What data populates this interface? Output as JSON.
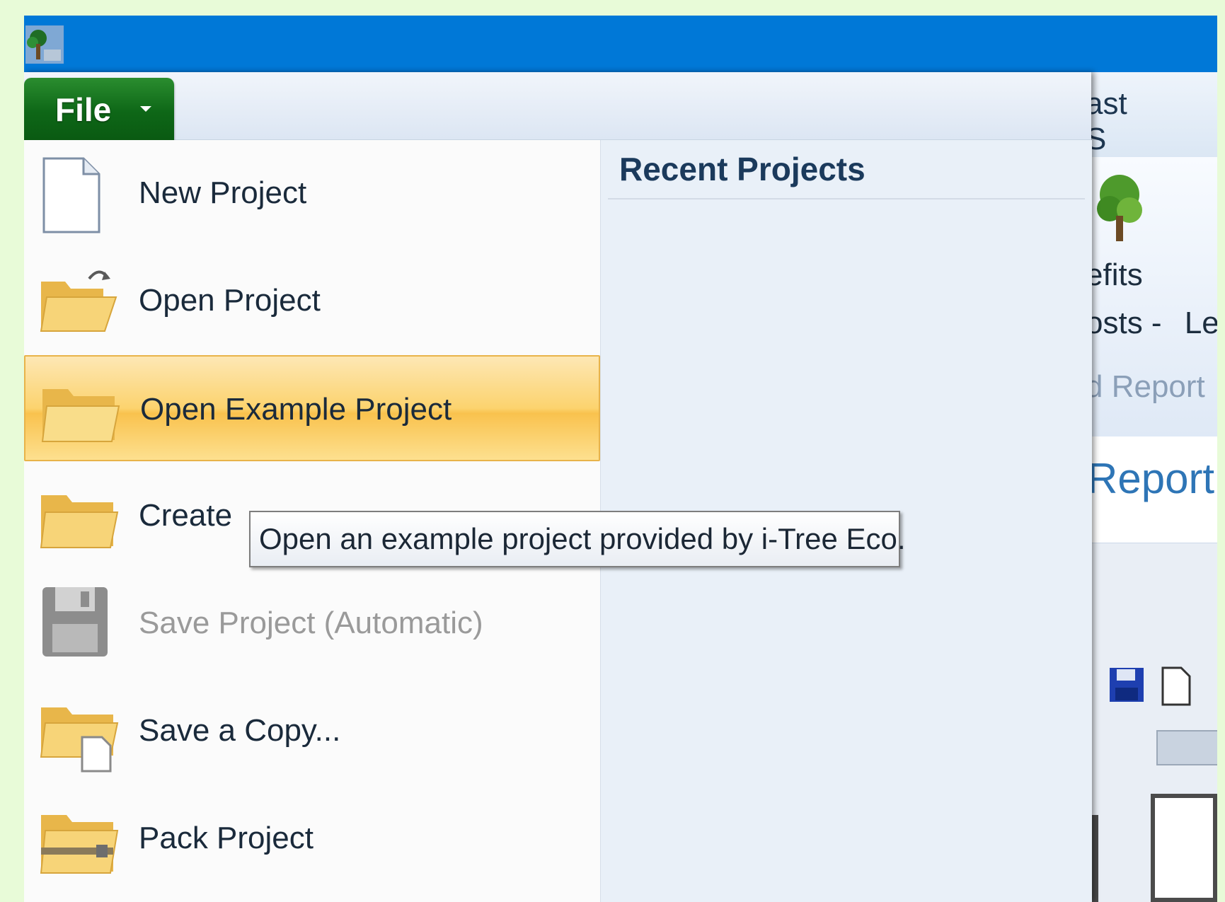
{
  "titlebar": {
    "icon": "tree-app-icon"
  },
  "file_menu": {
    "button_label": "File",
    "caret_icon": "chevron-down-icon",
    "items": [
      {
        "label": "New Project",
        "icon": "blank-document-icon",
        "state": "normal"
      },
      {
        "label": "Open Project",
        "icon": "open-folder-icon",
        "state": "normal"
      },
      {
        "label": "Open Example Project",
        "icon": "folder-icon",
        "state": "hover"
      },
      {
        "label": "Create",
        "icon": "folder-icon",
        "state": "normal"
      },
      {
        "label": "Save Project (Automatic)",
        "icon": "floppy-disk-icon",
        "state": "disabled"
      },
      {
        "label": "Save a Copy...",
        "icon": "folder-copy-icon",
        "state": "normal"
      },
      {
        "label": "Pack Project",
        "icon": "pack-folder-icon",
        "state": "normal"
      }
    ],
    "recent_projects_title": "Recent Projects"
  },
  "tooltip": {
    "text": "Open an example project provided by i-Tree Eco."
  },
  "background_ribbon": {
    "tabs": [
      "ast",
      "S"
    ],
    "benefits_label": "efits",
    "costs_label": "osts -",
    "costs_extra": "Le",
    "group_label": "d Report",
    "report_title": "Report"
  },
  "colors": {
    "titlebar": "#0078d7",
    "file_button": "#137a1d",
    "hover_highlight": "#fcd36e",
    "page_background": "#e8fbd8"
  }
}
